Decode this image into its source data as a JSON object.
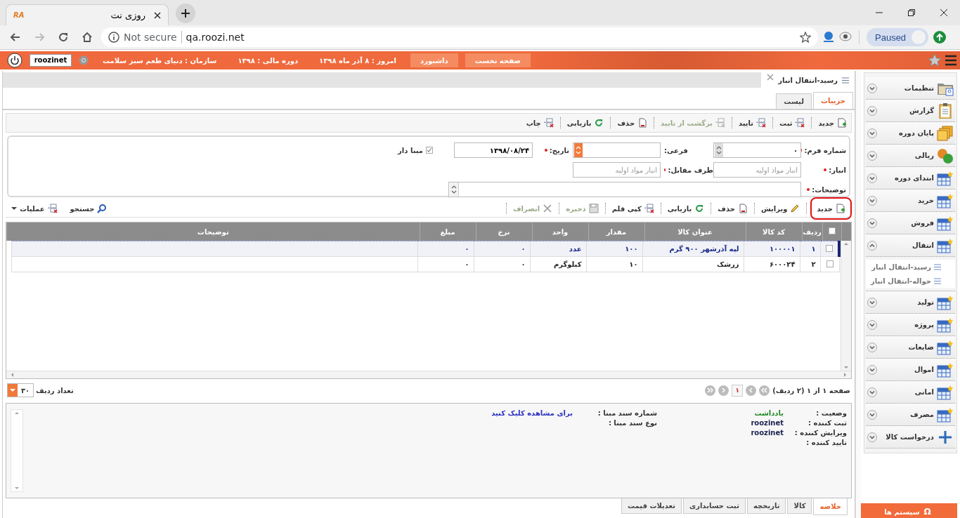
{
  "browser": {
    "tab": {
      "logo": "RA",
      "title": "روزی نت"
    },
    "security": "Not secure",
    "url": "qa.roozi.net",
    "profile": "Paused"
  },
  "app_bar": {
    "user": "roozinet",
    "buttons": [
      "صفحه نخست",
      "داشبورد"
    ],
    "info": [
      "امروز : ۸ آذر ماه ۱۳۹۸",
      "دوره مالی : ۱۳۹۸",
      "سازمان : دنیای طعم سبز سلامت"
    ]
  },
  "document": {
    "title": "رسید-انتقال انبار",
    "tabs": [
      {
        "label": "جزییات",
        "selected": true
      },
      {
        "label": "لیست",
        "selected": false
      }
    ],
    "toolbar": [
      {
        "label": "جدید",
        "kind": "new",
        "disabled": false
      },
      {
        "label": "ثبت",
        "kind": "post",
        "disabled": false
      },
      {
        "label": "تایید",
        "kind": "post",
        "disabled": false
      },
      {
        "label": "برگشت از تایید",
        "kind": "post",
        "disabled": true
      },
      {
        "label": "حذف",
        "kind": "remove",
        "disabled": false
      },
      {
        "label": "بازیابی",
        "kind": "restore",
        "disabled": false
      },
      {
        "label": "چاپ",
        "kind": "post",
        "disabled": false
      }
    ],
    "form": [
      [
        {
          "label": "شماره فرم:",
          "required": true,
          "kind": "spinner",
          "value": "۰"
        },
        {
          "label": "فرعی:",
          "kind": "select"
        },
        {
          "label": "تاریخ:",
          "required": true,
          "kind": "text",
          "value": "۱۳۹۸/۰۸/۲۴"
        },
        {
          "label": "مبنا دار",
          "kind": "checkbox",
          "checked": true
        }
      ],
      [
        {
          "label": "انبار:",
          "required": true,
          "kind": "text",
          "placeholder": "انبار مواد اولیه"
        },
        {
          "label": "طرف مقابل:",
          "required": true,
          "kind": "text",
          "placeholder": "انبار مواد اولیه"
        }
      ],
      [
        {
          "label": "توضیحات:",
          "required": true,
          "kind": "textarea"
        }
      ]
    ],
    "grid_toolbar": {
      "actions": [
        {
          "label": "جدید",
          "kind": "new",
          "disabled": false,
          "highlighted": true
        },
        {
          "label": "ویرایش",
          "kind": "edit",
          "disabled": false
        },
        {
          "label": "حذف",
          "kind": "remove",
          "disabled": false
        },
        {
          "label": "بازیابی",
          "kind": "restore",
          "disabled": false
        },
        {
          "label": "کپی قلم",
          "kind": "post",
          "disabled": false
        },
        {
          "label": "ذخیره",
          "kind": "save",
          "disabled": true
        },
        {
          "label": "انصراف",
          "kind": "cancel",
          "disabled": true
        }
      ],
      "tools": [
        {
          "label": "جستجو",
          "kind": "search"
        },
        {
          "label": "عملیات",
          "kind": "post",
          "menu": true
        }
      ]
    },
    "table": {
      "all_checked": false,
      "columns": [
        "ردیف",
        "کد کالا",
        "عنوان کالا",
        "مقدار",
        "واحد",
        "نرخ",
        "مبلغ",
        "توضیحات"
      ],
      "rows": [
        {
          "selected": true,
          "checked": false,
          "cells": [
            "۱",
            "۱۰۰۰۰۱",
            "لپه آذرشهر ۹۰۰ گرم",
            "۱۰۰",
            "عدد",
            "۰",
            "۰"
          ]
        },
        {
          "selected": false,
          "checked": false,
          "cells": [
            "۲",
            "۶۰۰۰۲۴",
            "زرشک",
            "۱۰",
            "کیلوگرم",
            "۰",
            "۰"
          ]
        }
      ]
    },
    "pager": {
      "summary": "صفحه ۱ از ۱ (۲ ردیف)",
      "page": "۱",
      "page_size_label": "تعداد ردیف",
      "page_size": "۳۰"
    },
    "summary": {
      "fields": [
        {
          "label": "وضعیت :",
          "value": "یادداشت",
          "kind": "status"
        },
        {
          "label": "ثبت کننده :",
          "value": "roozinet",
          "kind": "text"
        },
        {
          "label": "ویرایش کننده :",
          "value": "roozinet",
          "kind": "text"
        },
        {
          "label": "تایید کننده :"
        }
      ],
      "source_fields": [
        {
          "label": "شماره سند مبنا :",
          "value": "برای مشاهده کلیک کنید",
          "kind": "link"
        },
        {
          "label": "نوع سند مبنا :"
        }
      ]
    },
    "bottom_tabs": [
      {
        "label": "خلاصه",
        "selected": true
      },
      {
        "label": "کالا",
        "selected": false
      },
      {
        "label": "تاریخچه",
        "selected": false
      },
      {
        "label": "ثبت حسابداری",
        "selected": false
      },
      {
        "label": "تعدیلات قیمت",
        "selected": false
      }
    ]
  },
  "sidebar": {
    "items": [
      {
        "label": "تنظیمات",
        "kind": "folder",
        "expanded": false
      },
      {
        "label": "گزارش",
        "kind": "clipboard",
        "expanded": false
      },
      {
        "label": "پایان دوره",
        "kind": "stack",
        "expanded": false
      },
      {
        "label": "ریالی",
        "kind": "coins",
        "expanded": false
      },
      {
        "label": "ابتدای دوره",
        "kind": "table",
        "expanded": false
      },
      {
        "label": "خرید",
        "kind": "table",
        "expanded": false
      },
      {
        "label": "فروش",
        "kind": "table",
        "expanded": false
      },
      {
        "label": "انتقال",
        "kind": "table",
        "expanded": true,
        "children": [
          {
            "label": "رسید-انتقال انبار"
          },
          {
            "label": "حواله-انتقال انبار"
          }
        ]
      },
      {
        "label": "تولید",
        "kind": "table",
        "expanded": false
      },
      {
        "label": "پروژه",
        "kind": "table",
        "expanded": false
      },
      {
        "label": "ضایعات",
        "kind": "table",
        "expanded": false
      },
      {
        "label": "اموال",
        "kind": "table",
        "expanded": false
      },
      {
        "label": "امانی",
        "kind": "table",
        "expanded": false
      },
      {
        "label": "مصرف",
        "kind": "table",
        "expanded": false
      },
      {
        "label": "درخواست کالا",
        "kind": "plus",
        "expanded": false
      }
    ],
    "systems_button": {
      "symbol": "Ω",
      "label": "سیستم ها"
    }
  }
}
